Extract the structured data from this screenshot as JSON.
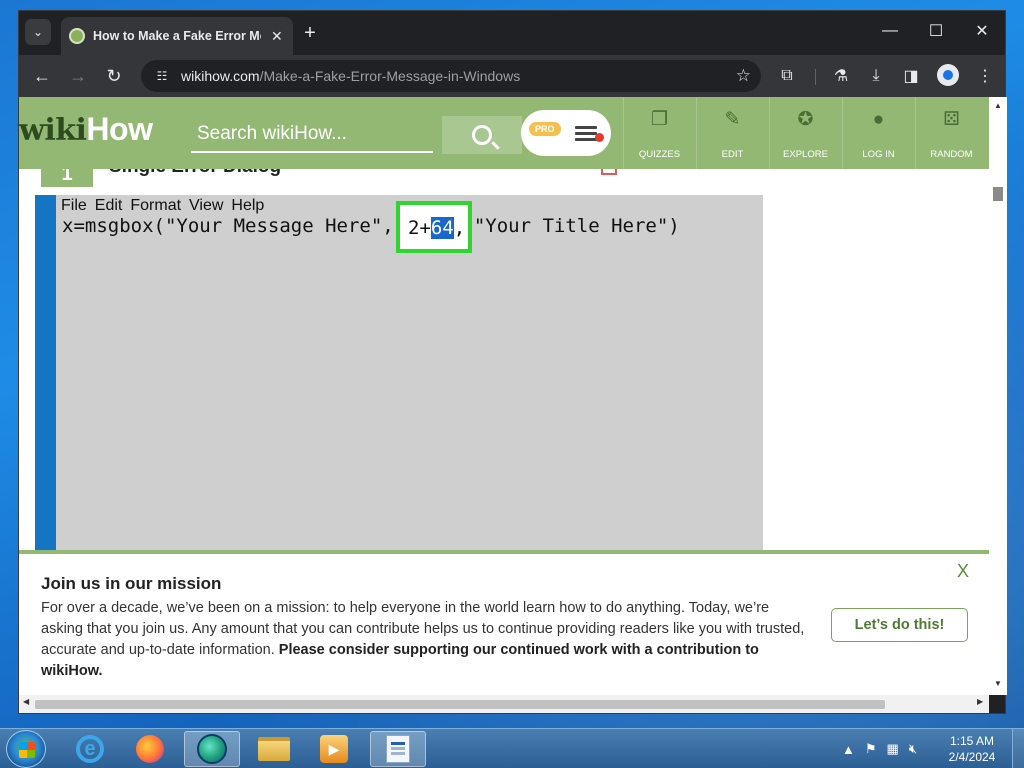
{
  "browser": {
    "tab_title": "How to Make a Fake Error Mes",
    "url_host": "wikihow.com",
    "url_path": "/Make-a-Fake-Error-Message-in-Windows"
  },
  "wikihow": {
    "logo_wiki": "wiki",
    "logo_how": "How",
    "search_placeholder": "Search wikiHow...",
    "pro_badge": "PRO",
    "nav": [
      {
        "label": "QUIZZES",
        "icon": "quizzes-icon"
      },
      {
        "label": "EDIT",
        "icon": "pencil-icon"
      },
      {
        "label": "EXPLORE",
        "icon": "compass-icon"
      },
      {
        "label": "LOG IN",
        "icon": "user-icon"
      },
      {
        "label": "RANDOM",
        "icon": "dice-icon"
      }
    ]
  },
  "step": {
    "number": "1",
    "title": "Single Error Dialog",
    "notepad_menu": [
      "File",
      "Edit",
      "Format",
      "View",
      "Help"
    ],
    "code_before": "x=msgbox(\"Your Message Here\", ",
    "code_plain": "2+",
    "code_selected": "64",
    "code_comma": ",",
    "code_after": " \"Your Title Here\")"
  },
  "banner": {
    "title": "Join us in our mission",
    "body": "For over a decade, we’ve been on a mission: to help everyone in the world learn how to do anything. Today, we’re asking that you join us. Any amount that you can contribute helps us to continue providing readers like you with trusted, accurate and up-to-date information. ",
    "body_bold": "Please consider supporting our continued work with a contribution to wikiHow.",
    "cta": "Let’s do this!",
    "close": "X"
  },
  "taskbar": {
    "time": "1:15 AM",
    "date": "2/4/2024"
  },
  "colors": {
    "wikihow_green": "#93b874",
    "selection_blue": "#1a66c9",
    "highlight_green": "#2fd62f"
  }
}
